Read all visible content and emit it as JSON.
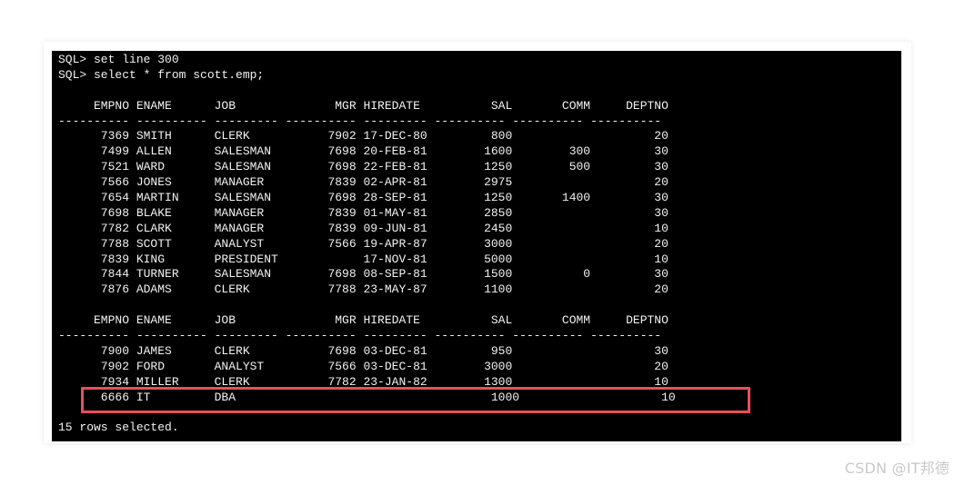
{
  "console": {
    "lines": [
      "SQL> set line 300",
      "SQL> select * from scott.emp;",
      "",
      "     EMPNO ENAME      JOB              MGR HIREDATE          SAL       COMM     DEPTNO",
      "---------- ---------- --------- ---------- --------- ---------- ---------- ----------",
      "      7369 SMITH      CLERK           7902 17-DEC-80         800                    20",
      "      7499 ALLEN      SALESMAN        7698 20-FEB-81        1600        300         30",
      "      7521 WARD       SALESMAN        7698 22-FEB-81        1250        500         30",
      "      7566 JONES      MANAGER         7839 02-APR-81        2975                    20",
      "      7654 MARTIN     SALESMAN        7698 28-SEP-81        1250       1400         30",
      "      7698 BLAKE      MANAGER         7839 01-MAY-81        2850                    30",
      "      7782 CLARK      MANAGER         7839 09-JUN-81        2450                    10",
      "      7788 SCOTT      ANALYST         7566 19-APR-87        3000                    20",
      "      7839 KING       PRESIDENT            17-NOV-81        5000                    10",
      "      7844 TURNER     SALESMAN        7698 08-SEP-81        1500          0         30",
      "      7876 ADAMS      CLERK           7788 23-MAY-87        1100                    20",
      "",
      "     EMPNO ENAME      JOB              MGR HIREDATE          SAL       COMM     DEPTNO",
      "---------- ---------- --------- ---------- --------- ---------- ---------- ----------",
      "      7900 JAMES      CLERK           7698 03-DEC-81         950                    30",
      "      7902 FORD       ANALYST         7566 03-DEC-81        3000                    20",
      "      7934 MILLER     CLERK           7782 23-JAN-82        1300                    10",
      "      6666 IT         DBA                                    1000                    10",
      "",
      "15 rows selected."
    ]
  },
  "watermark": {
    "text": "CSDN @IT邦德"
  },
  "colors": {
    "terminal_bg": "#000000",
    "terminal_text": "#f2f2f2",
    "highlight": "#e8505b",
    "page_bg": "#ffffff"
  }
}
